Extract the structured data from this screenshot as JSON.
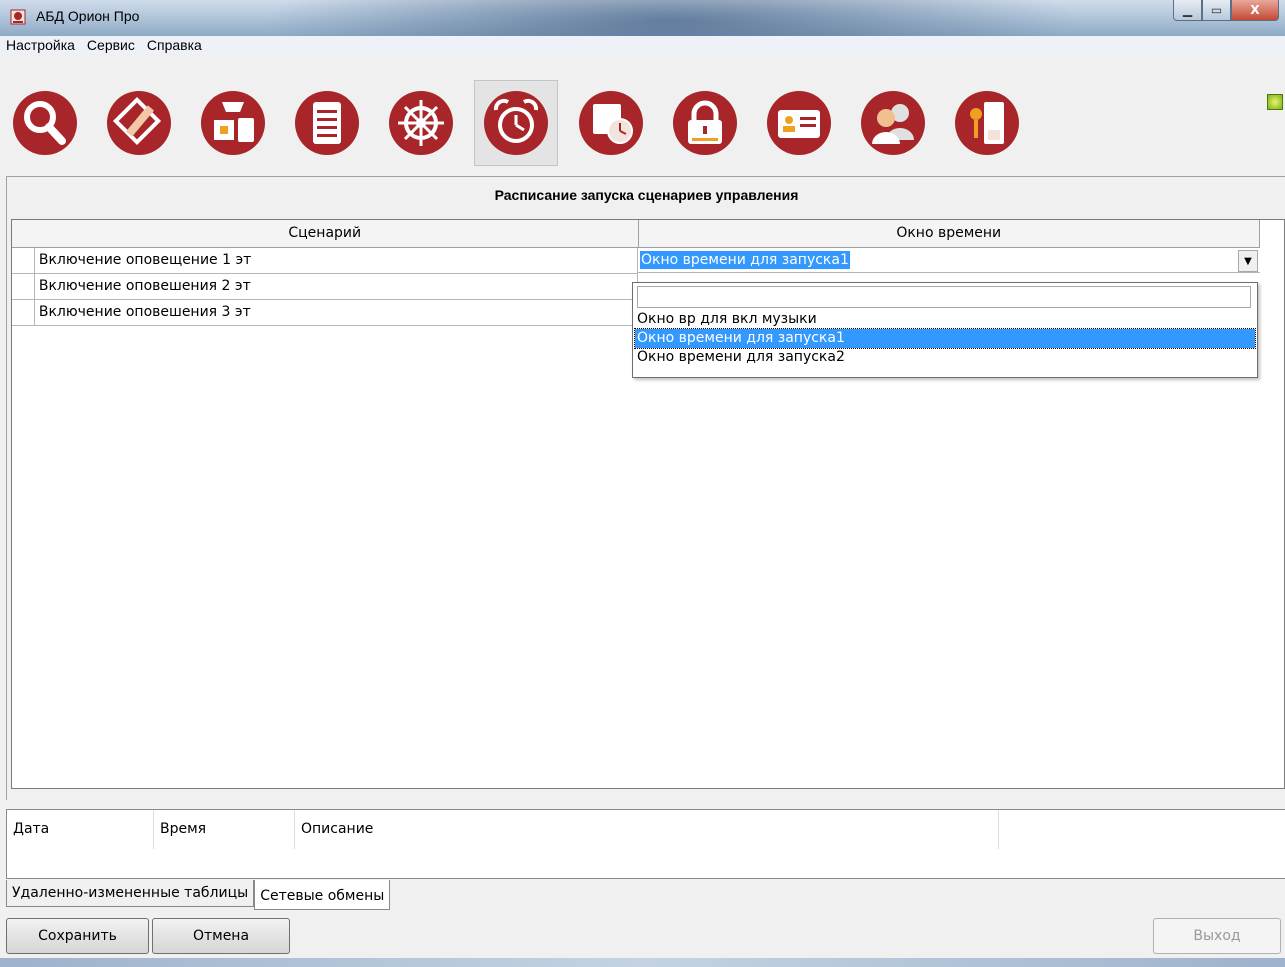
{
  "window": {
    "title": "АБД Орион Про"
  },
  "menu": {
    "items": [
      "Настройка",
      "Сервис",
      "Справка"
    ]
  },
  "toolbar": {
    "buttons": [
      {
        "icon": "search-icon"
      },
      {
        "icon": "floor-plan-edit-icon"
      },
      {
        "icon": "devices-icon"
      },
      {
        "icon": "document-list-icon"
      },
      {
        "icon": "ship-wheel-icon"
      },
      {
        "icon": "alarm-clock-icon",
        "active": true
      },
      {
        "icon": "schedule-clock-icon"
      },
      {
        "icon": "padlock-icon"
      },
      {
        "icon": "id-card-icon"
      },
      {
        "icon": "users-icon"
      },
      {
        "icon": "key-door-icon"
      }
    ],
    "accent": "#a8262a"
  },
  "panel": {
    "title": "Расписание запуска сценариев управления",
    "columns": {
      "scenario": "Сценарий",
      "time_window": "Окно времени"
    },
    "rows": [
      {
        "scenario": "Включение оповещение 1 эт"
      },
      {
        "scenario": "Включение оповешения 2 эт"
      },
      {
        "scenario": "Включение оповешения 3 эт"
      }
    ],
    "combo_value": "Окно времени для запуска1",
    "dropdown_options": [
      "Окно вр для вкл музыки",
      "Окно времени для запуска1",
      "Окно времени для запуска2"
    ],
    "selected_color": "#3399ff"
  },
  "log": {
    "columns": [
      "Дата",
      "Время",
      "Описание"
    ]
  },
  "tabs": [
    "Удаленно-измененные таблицы",
    "Сетевые обмены"
  ],
  "buttons": {
    "save": "Сохранить",
    "cancel": "Отмена",
    "exit": "Выход"
  }
}
